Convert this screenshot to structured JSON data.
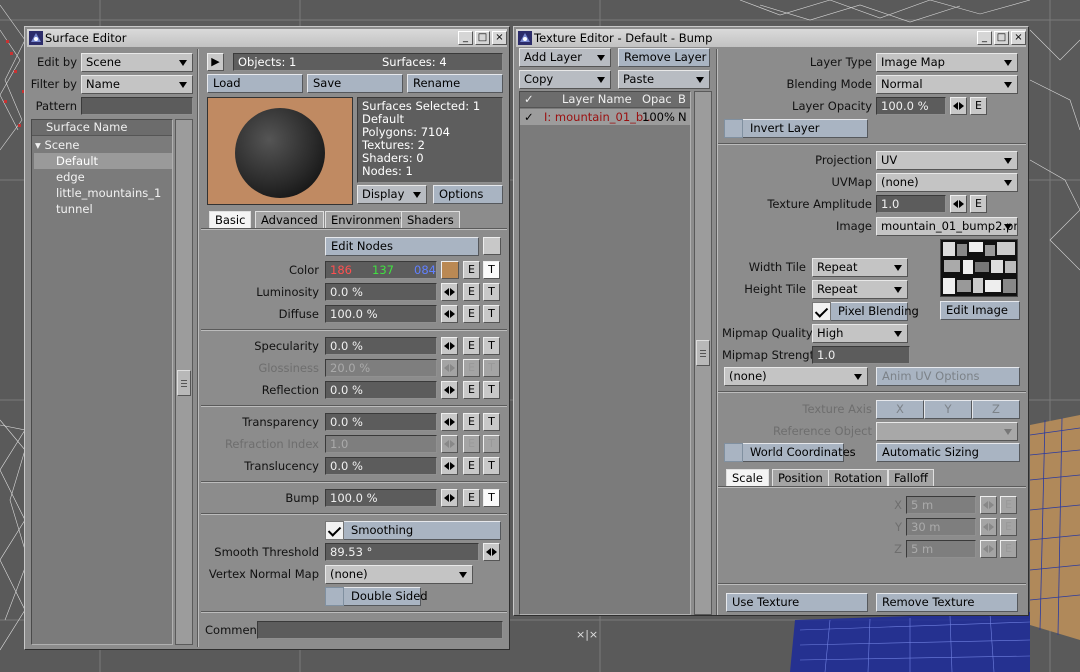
{
  "surface_editor": {
    "title": "Surface Editor",
    "edit_by_label": "Edit by",
    "edit_by_value": "Scene",
    "filter_by_label": "Filter by",
    "filter_by_value": "Name",
    "pattern_label": "Pattern",
    "list_header": "Surface Name",
    "tree_root": "Scene",
    "surfaces": [
      "Default",
      "edge",
      "little_mountains_1",
      "tunnel"
    ],
    "objects_text": "Objects: 1",
    "surfaces_text": "Surfaces: 4",
    "load_label": "Load",
    "save_label": "Save",
    "rename_label": "Rename",
    "info": [
      "Surfaces Selected: 1",
      "Default",
      "Polygons: 7104",
      "Textures: 2",
      "Shaders: 0",
      "Nodes: 1"
    ],
    "display_label": "Display",
    "options_label": "Options",
    "tabs": [
      "Basic",
      "Advanced",
      "Environment",
      "Shaders"
    ],
    "edit_nodes_label": "Edit Nodes",
    "color_label": "Color",
    "color_r": "186",
    "color_g": "137",
    "color_b": "084",
    "swatch_color": "#ba8954",
    "luminosity_label": "Luminosity",
    "luminosity_value": "0.0 %",
    "diffuse_label": "Diffuse",
    "diffuse_value": "100.0 %",
    "specularity_label": "Specularity",
    "specularity_value": "0.0 %",
    "glossiness_label": "Glossiness",
    "glossiness_value": "20.0 %",
    "reflection_label": "Reflection",
    "reflection_value": "0.0 %",
    "transparency_label": "Transparency",
    "transparency_value": "0.0 %",
    "refraction_label": "Refraction Index",
    "refraction_value": "1.0",
    "translucency_label": "Translucency",
    "translucency_value": "0.0 %",
    "bump_label": "Bump",
    "bump_value": "100.0 %",
    "smoothing_label": "Smoothing",
    "smooth_threshold_label": "Smooth Threshold",
    "smooth_threshold_value": "89.53 °",
    "vertex_normal_label": "Vertex Normal Map",
    "vertex_normal_value": "(none)",
    "double_sided_label": "Double Sided",
    "comment_label": "Comment",
    "e_label": "E",
    "t_label": "T"
  },
  "texture_editor": {
    "title": "Texture Editor - Default - Bump",
    "add_layer_label": "Add Layer",
    "remove_layer_label": "Remove Layer",
    "copy_label": "Copy",
    "paste_label": "Paste",
    "col_layer_name": "Layer Name",
    "col_opac": "Opac",
    "col_b": "B",
    "layer_name": "I: mountain_01_b...",
    "layer_opac": "100%",
    "layer_b": "N",
    "layer_type_label": "Layer Type",
    "layer_type_value": "Image Map",
    "blending_mode_label": "Blending Mode",
    "blending_mode_value": "Normal",
    "layer_opacity_label": "Layer Opacity",
    "layer_opacity_value": "100.0 %",
    "invert_layer_label": "Invert Layer",
    "projection_label": "Projection",
    "projection_value": "UV",
    "uvmap_label": "UVMap",
    "uvmap_value": "(none)",
    "texture_amplitude_label": "Texture Amplitude",
    "texture_amplitude_value": "1.0",
    "image_label": "Image",
    "image_value": "mountain_01_bump2.png",
    "width_tile_label": "Width Tile",
    "width_tile_value": "Repeat",
    "height_tile_label": "Height Tile",
    "height_tile_value": "Repeat",
    "pixel_blending_label": "Pixel Blending",
    "edit_image_label": "Edit Image",
    "mipmap_quality_label": "Mipmap Quality",
    "mipmap_quality_value": "High",
    "mipmap_strength_label": "Mipmap Strength",
    "mipmap_strength_value": "1.0",
    "none_dd_value": "(none)",
    "anim_uv_label": "Anim UV Options",
    "texture_axis_label": "Texture Axis",
    "axis_x": "X",
    "axis_y": "Y",
    "axis_z": "Z",
    "reference_object_label": "Reference Object",
    "world_coords_label": "World Coordinates",
    "auto_sizing_label": "Automatic Sizing",
    "tabs": [
      "Scale",
      "Position",
      "Rotation",
      "Falloff"
    ],
    "scale_x_label": "X",
    "scale_x_value": "5 m",
    "scale_y_label": "Y",
    "scale_y_value": "30 m",
    "scale_z_label": "Z",
    "scale_z_value": "5 m",
    "use_texture_label": "Use Texture",
    "remove_texture_label": "Remove Texture",
    "e_label": "E"
  },
  "viewport": {
    "marker_text": "×|×"
  }
}
